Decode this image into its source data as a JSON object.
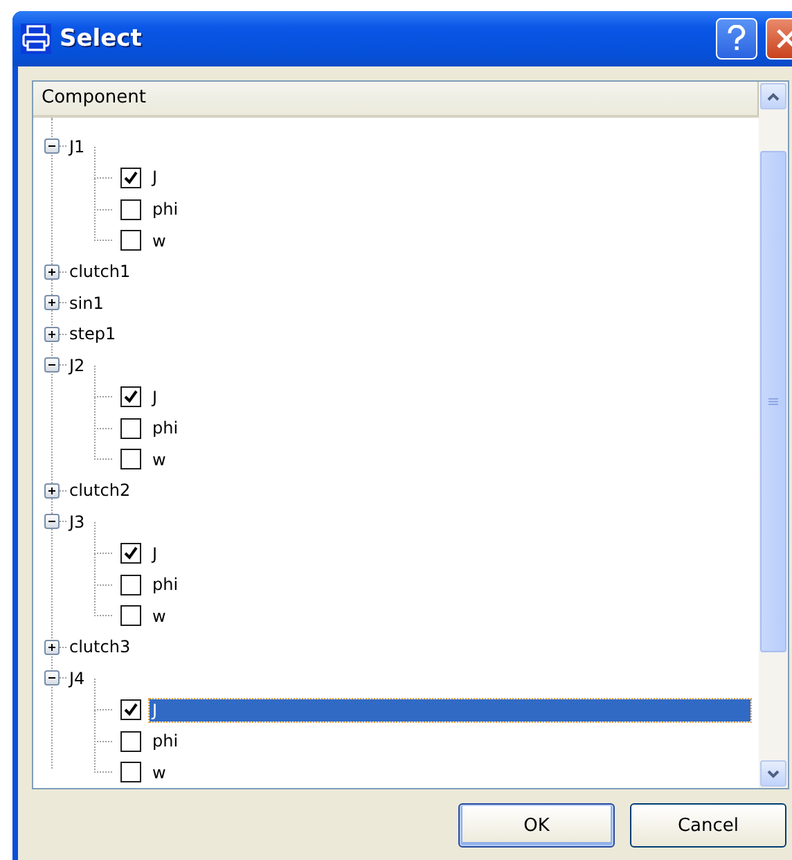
{
  "window": {
    "title": "Select"
  },
  "tree": {
    "header": "Component",
    "items": [
      {
        "label": "J1",
        "expanded": true,
        "children": [
          {
            "label": "J",
            "checked": true,
            "selected": false
          },
          {
            "label": "phi",
            "checked": false,
            "selected": false
          },
          {
            "label": "w",
            "checked": false,
            "selected": false
          }
        ]
      },
      {
        "label": "clutch1",
        "expanded": false
      },
      {
        "label": "sin1",
        "expanded": false
      },
      {
        "label": "step1",
        "expanded": false
      },
      {
        "label": "J2",
        "expanded": true,
        "children": [
          {
            "label": "J",
            "checked": true,
            "selected": false
          },
          {
            "label": "phi",
            "checked": false,
            "selected": false
          },
          {
            "label": "w",
            "checked": false,
            "selected": false
          }
        ]
      },
      {
        "label": "clutch2",
        "expanded": false
      },
      {
        "label": "J3",
        "expanded": true,
        "children": [
          {
            "label": "J",
            "checked": true,
            "selected": false
          },
          {
            "label": "phi",
            "checked": false,
            "selected": false
          },
          {
            "label": "w",
            "checked": false,
            "selected": false
          }
        ]
      },
      {
        "label": "clutch3",
        "expanded": false
      },
      {
        "label": "J4",
        "expanded": true,
        "children": [
          {
            "label": "J",
            "checked": true,
            "selected": true
          },
          {
            "label": "phi",
            "checked": false,
            "selected": false
          },
          {
            "label": "w",
            "checked": false,
            "selected": false
          }
        ]
      }
    ]
  },
  "buttons": [
    {
      "label": "OK",
      "kind": "default"
    },
    {
      "label": "Cancel",
      "kind": "normal"
    }
  ]
}
